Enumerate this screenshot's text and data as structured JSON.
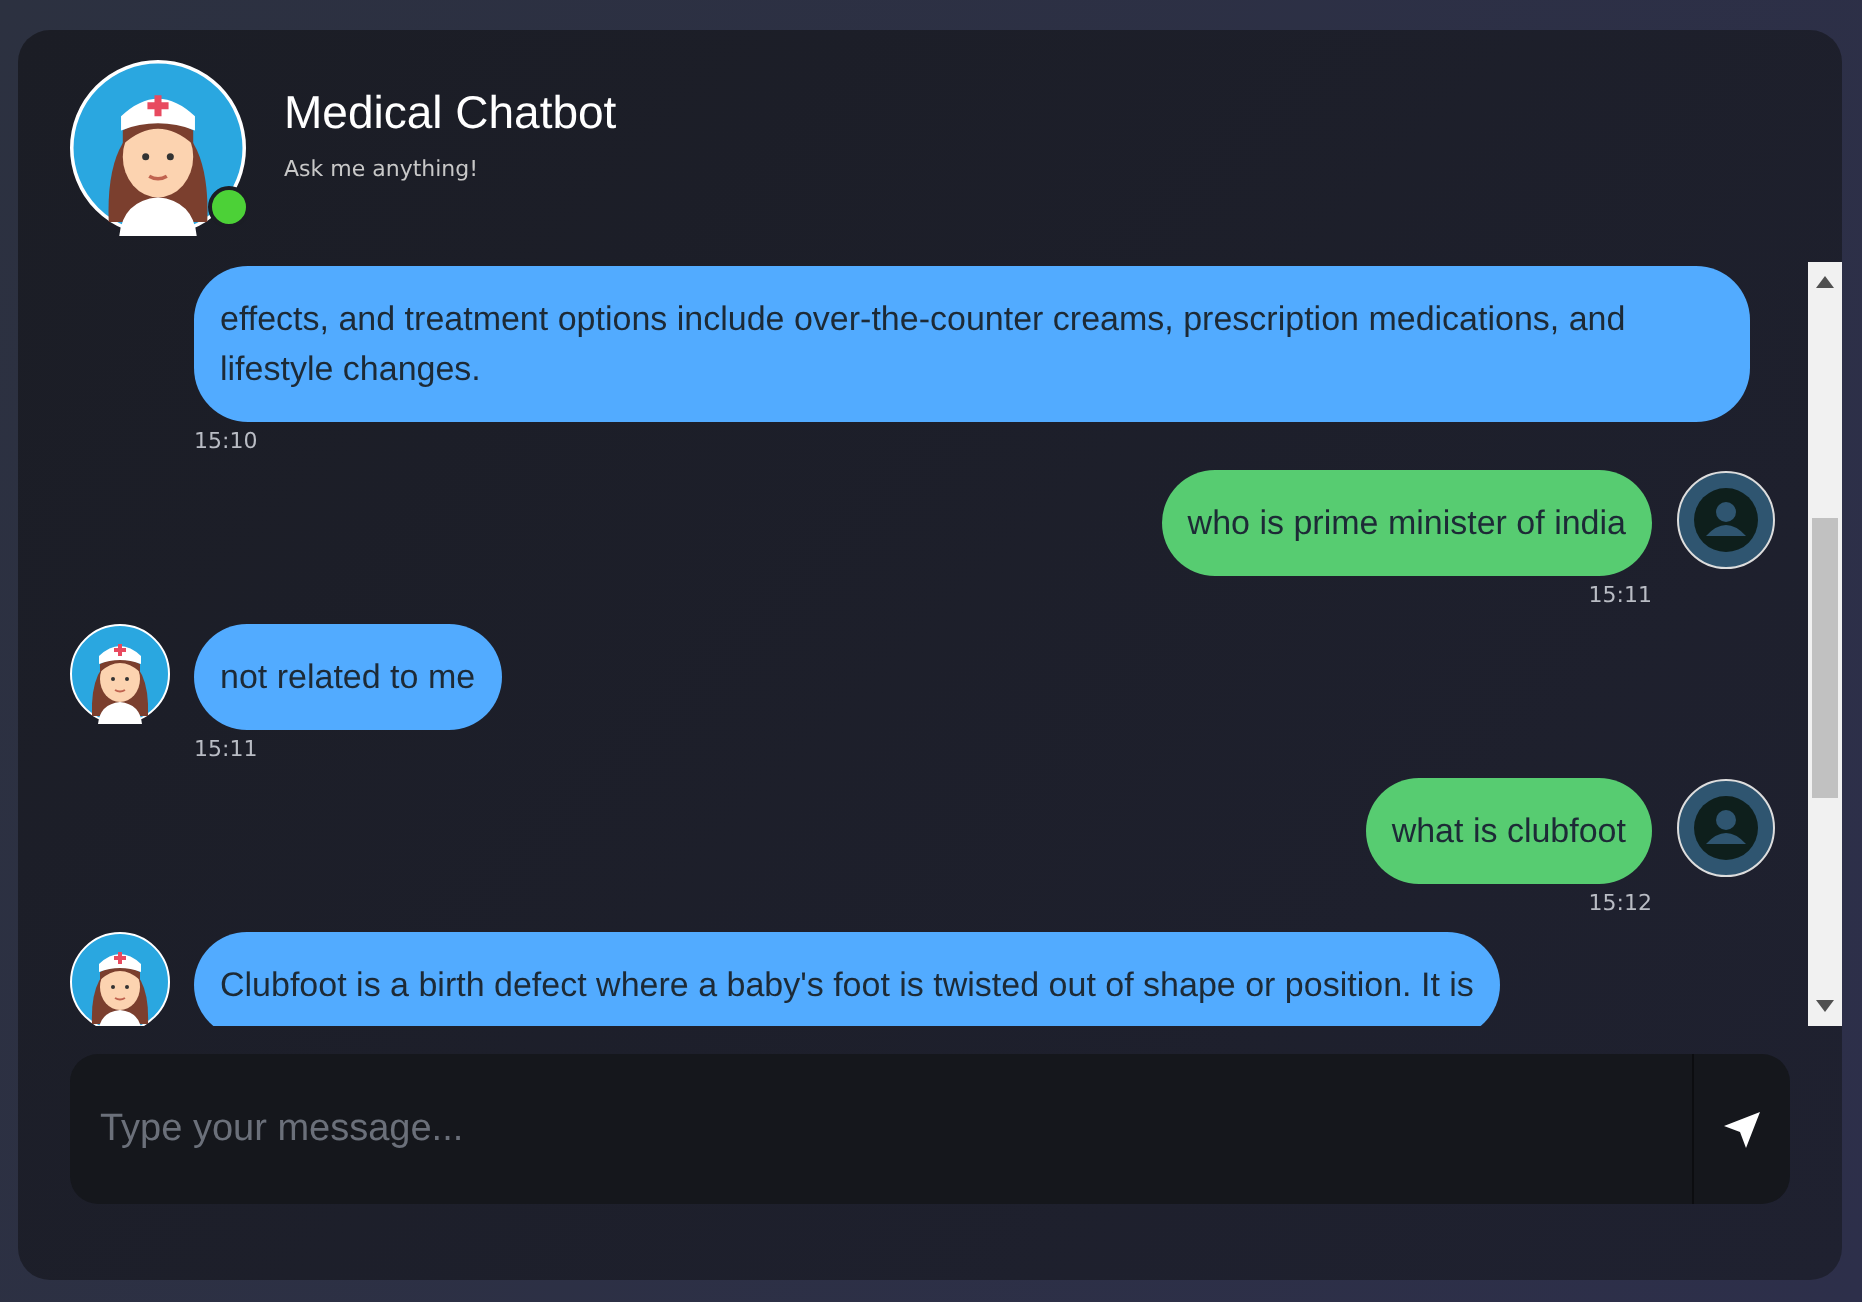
{
  "header": {
    "title": "Medical Chatbot",
    "subtitle": "Ask me anything!",
    "online": true
  },
  "messages": [
    {
      "kind": "bot",
      "text": "effects, and treatment options include over-the-counter creams, prescription medications, and lifestyle changes.",
      "time": "15:10",
      "avatar": false
    },
    {
      "kind": "user",
      "text": "who is prime minister of india",
      "time": "15:11",
      "avatar": true
    },
    {
      "kind": "bot",
      "text": "not related to me",
      "time": "15:11",
      "avatar": true
    },
    {
      "kind": "user",
      "text": "what is clubfoot",
      "time": "15:12",
      "avatar": true
    },
    {
      "kind": "bot",
      "text": "Clubfoot is a birth defect where a baby's foot is twisted out of shape or position. It is",
      "avatar": true
    }
  ],
  "composer": {
    "placeholder": "Type your message..."
  }
}
